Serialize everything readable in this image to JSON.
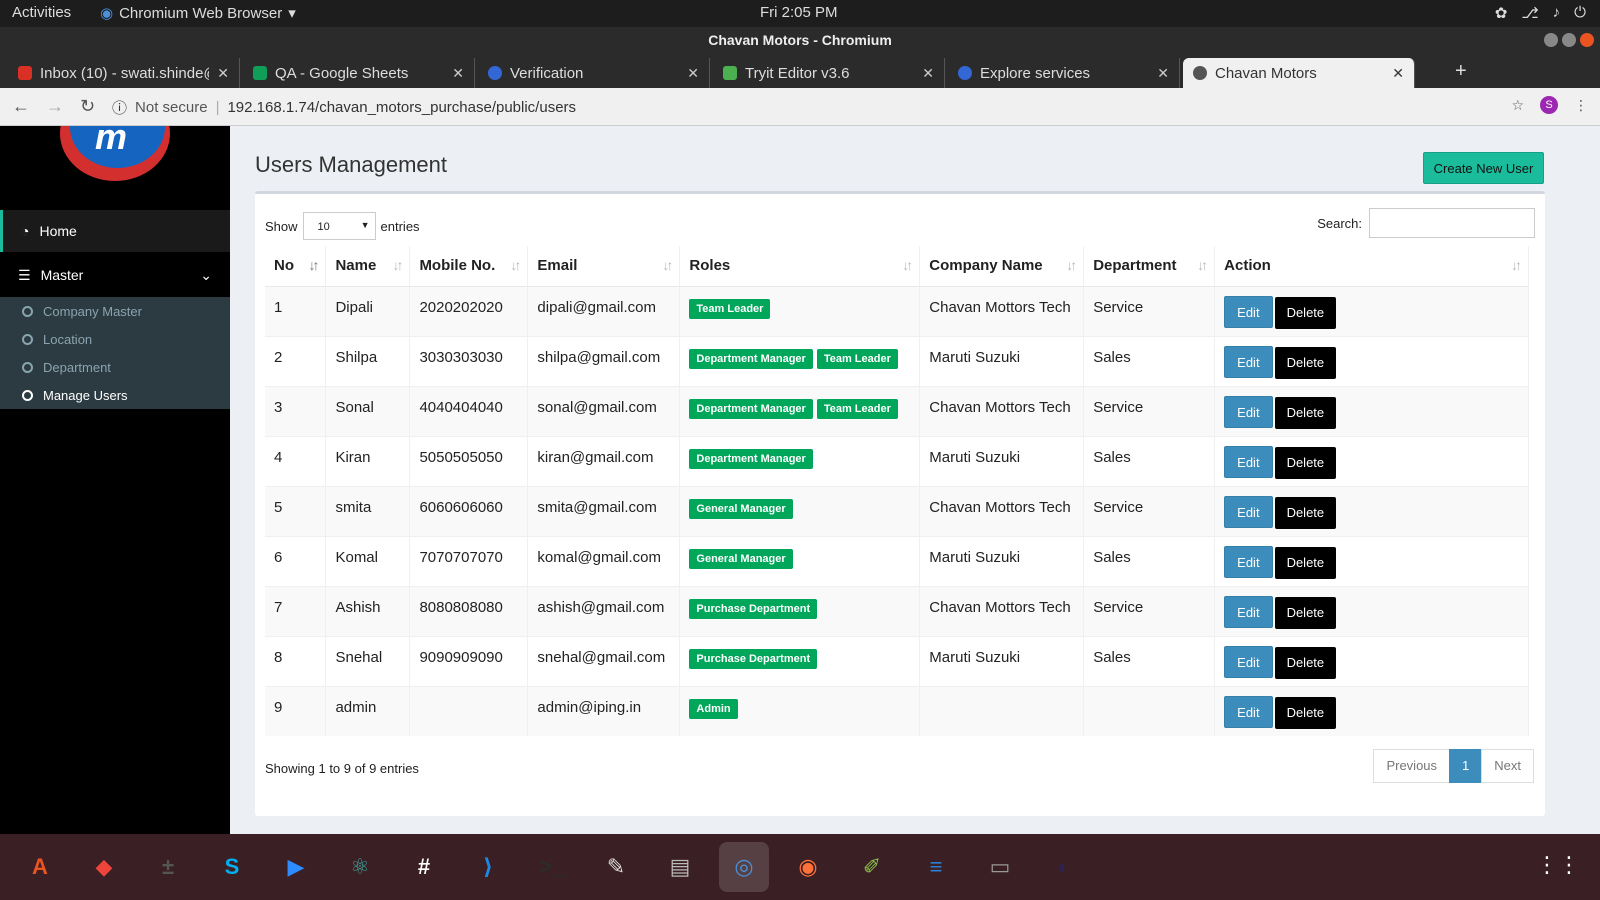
{
  "topbar": {
    "activities": "Activities",
    "app": "Chromium Web Browser",
    "clock": "Fri  2:05 PM"
  },
  "window": {
    "title": "Chavan Motors - Chromium"
  },
  "tabs": [
    {
      "label": "Inbox (10) - swati.shinde@",
      "fav_color": "#d93025"
    },
    {
      "label": "QA - Google Sheets",
      "fav_color": "#0f9d58"
    },
    {
      "label": "Verification",
      "fav_color": "#3367d6"
    },
    {
      "label": "Tryit Editor v3.6",
      "fav_color": "#4caf50"
    },
    {
      "label": "Explore services",
      "fav_color": "#3367d6"
    },
    {
      "label": "Chavan Motors",
      "fav_color": "#555555"
    }
  ],
  "address": {
    "security": "Not secure",
    "url": "192.168.1.74/chavan_motors_purchase/public/users",
    "profile": "S"
  },
  "sidebar": {
    "home": "Home",
    "master": "Master",
    "subitems": [
      "Company Master",
      "Location",
      "Department",
      "Manage Users"
    ]
  },
  "page": {
    "title": "Users Management",
    "create_button": "Create New User",
    "show_label": "Show",
    "entries_label": "entries",
    "page_size": "10",
    "search_label": "Search:",
    "search_value": "",
    "info": "Showing 1 to 9 of 9 entries",
    "prev": "Previous",
    "current_page": "1",
    "next": "Next",
    "edit_label": "Edit",
    "delete_label": "Delete"
  },
  "table": {
    "headers": [
      "No",
      "Name",
      "Mobile No.",
      "Email",
      "Roles",
      "Company Name",
      "Department",
      "Action"
    ],
    "rows": [
      {
        "no": "1",
        "name": "Dipali",
        "mobile": "2020202020",
        "email": "dipali@gmail.com",
        "roles": [
          "Team Leader"
        ],
        "company": "Chavan Mottors Tech",
        "dept": "Service"
      },
      {
        "no": "2",
        "name": "Shilpa",
        "mobile": "3030303030",
        "email": "shilpa@gmail.com",
        "roles": [
          "Department Manager",
          "Team Leader"
        ],
        "company": "Maruti Suzuki",
        "dept": "Sales"
      },
      {
        "no": "3",
        "name": "Sonal",
        "mobile": "4040404040",
        "email": "sonal@gmail.com",
        "roles": [
          "Department Manager",
          "Team Leader"
        ],
        "company": "Chavan Mottors Tech",
        "dept": "Service"
      },
      {
        "no": "4",
        "name": "Kiran",
        "mobile": "5050505050",
        "email": "kiran@gmail.com",
        "roles": [
          "Department Manager"
        ],
        "company": "Maruti Suzuki",
        "dept": "Sales"
      },
      {
        "no": "5",
        "name": "smita",
        "mobile": "6060606060",
        "email": "smita@gmail.com",
        "roles": [
          "General Manager"
        ],
        "company": "Chavan Mottors Tech",
        "dept": "Service"
      },
      {
        "no": "6",
        "name": "Komal",
        "mobile": "7070707070",
        "email": "komal@gmail.com",
        "roles": [
          "General Manager"
        ],
        "company": "Maruti Suzuki",
        "dept": "Sales"
      },
      {
        "no": "7",
        "name": "Ashish",
        "mobile": "8080808080",
        "email": "ashish@gmail.com",
        "roles": [
          "Purchase Department"
        ],
        "company": "Chavan Mottors Tech",
        "dept": "Service"
      },
      {
        "no": "8",
        "name": "Snehal",
        "mobile": "9090909090",
        "email": "snehal@gmail.com",
        "roles": [
          "Purchase Department"
        ],
        "company": "Maruti Suzuki",
        "dept": "Sales"
      },
      {
        "no": "9",
        "name": "admin",
        "mobile": "",
        "email": "admin@iping.in",
        "roles": [
          "Admin"
        ],
        "company": "",
        "dept": ""
      }
    ]
  },
  "dock": [
    {
      "name": "software-center-icon",
      "glyph": "A",
      "color": "#e95420"
    },
    {
      "name": "anydesk-icon",
      "glyph": "◆",
      "color": "#ef443b"
    },
    {
      "name": "calculator-icon",
      "glyph": "±",
      "color": "#555555"
    },
    {
      "name": "skype-icon",
      "glyph": "S",
      "color": "#00aff0"
    },
    {
      "name": "zoom-icon",
      "glyph": "▶",
      "color": "#2d8cff"
    },
    {
      "name": "atom-icon",
      "glyph": "⚛",
      "color": "#3ba99c"
    },
    {
      "name": "slack-icon",
      "glyph": "#",
      "color": "#ffffff"
    },
    {
      "name": "vscode-icon",
      "glyph": "⟩",
      "color": "#1e88e5"
    },
    {
      "name": "terminal-icon",
      "glyph": ">_",
      "color": "#2c2c2c"
    },
    {
      "name": "text-editor-icon",
      "glyph": "✎",
      "color": "#dddddd"
    },
    {
      "name": "files-icon",
      "glyph": "▤",
      "color": "#bbbbbb"
    },
    {
      "name": "chromium-icon",
      "glyph": "◎",
      "color": "#4a90d9"
    },
    {
      "name": "firefox-icon",
      "glyph": "◉",
      "color": "#ff7139"
    },
    {
      "name": "notes-icon",
      "glyph": "✐",
      "color": "#8bc34a"
    },
    {
      "name": "writer-icon",
      "glyph": "≡",
      "color": "#2a7fd4"
    },
    {
      "name": "scanner-icon",
      "glyph": "▭",
      "color": "#999999"
    },
    {
      "name": "eclipse-icon",
      "glyph": "◐",
      "color": "#2c2255"
    }
  ]
}
